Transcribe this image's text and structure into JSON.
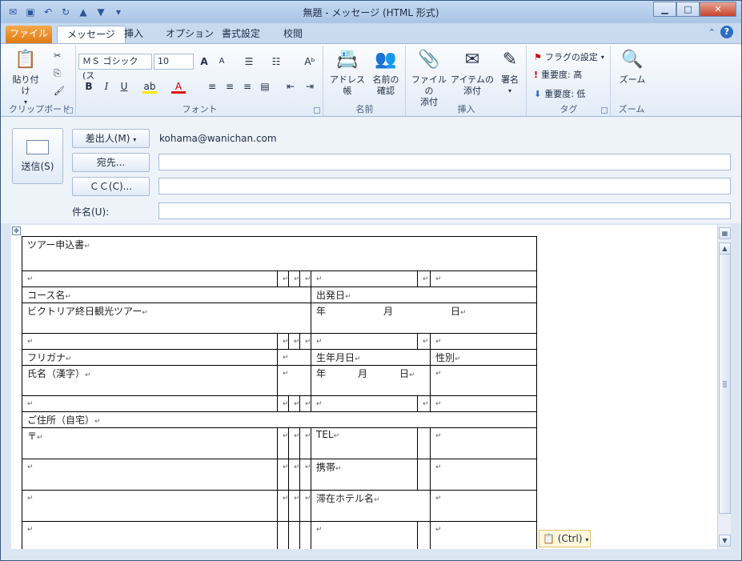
{
  "title": "無題 - メッセージ (HTML 形式)",
  "tabs": {
    "file": "ファイル",
    "message": "メッセージ",
    "insert": "挿入",
    "options": "オプション",
    "format": "書式設定",
    "review": "校閲"
  },
  "ribbon": {
    "clipboard": {
      "label": "クリップボード",
      "paste": "貼り付け"
    },
    "font": {
      "label": "フォント",
      "font_name": "ＭＳ ゴシック (ス",
      "font_size": "10"
    },
    "names": {
      "label": "名前",
      "address_book": "アドレス帳",
      "check_names_1": "名前の",
      "check_names_2": "確認"
    },
    "insert": {
      "label": "挿入",
      "attach_file_1": "ファイルの",
      "attach_file_2": "添付",
      "attach_item_1": "アイテムの",
      "attach_item_2": "添付",
      "signature": "署名"
    },
    "tags": {
      "label": "タグ",
      "flag": "フラグの設定",
      "high": "重要度: 高",
      "low": "重要度: 低"
    },
    "zoom": {
      "label": "ズーム",
      "zoom": "ズーム"
    }
  },
  "compose": {
    "send": "送信(S)",
    "from_button": "差出人(M)",
    "from_value": "kohama@wanichan.com",
    "to_button": "宛先...",
    "cc_button": "ＣＣ(C)...",
    "subject_label": "件名(U):",
    "to_value": "",
    "cc_value": "",
    "subject_value": ""
  },
  "form": {
    "title": "ツアー申込書",
    "course_label": "コース名",
    "course_value": "ビクトリア終日観光ツアー",
    "depart_label": "出発日",
    "depart_year": "年",
    "depart_month": "月",
    "depart_day": "日",
    "furigana_label": "フリガナ",
    "birth_label": "生年月日",
    "gender_label": "性別",
    "name_label": "氏名（漢字）",
    "birth_year": "年",
    "birth_month": "月",
    "birth_day": "日",
    "address_label": "ご住所（自宅）",
    "postal": "〒",
    "tel_label": "TEL",
    "mobile_label": "携帯",
    "hotel_label": "滞在ホテル名",
    "mark": "↵"
  },
  "paste_options": "(Ctrl)"
}
